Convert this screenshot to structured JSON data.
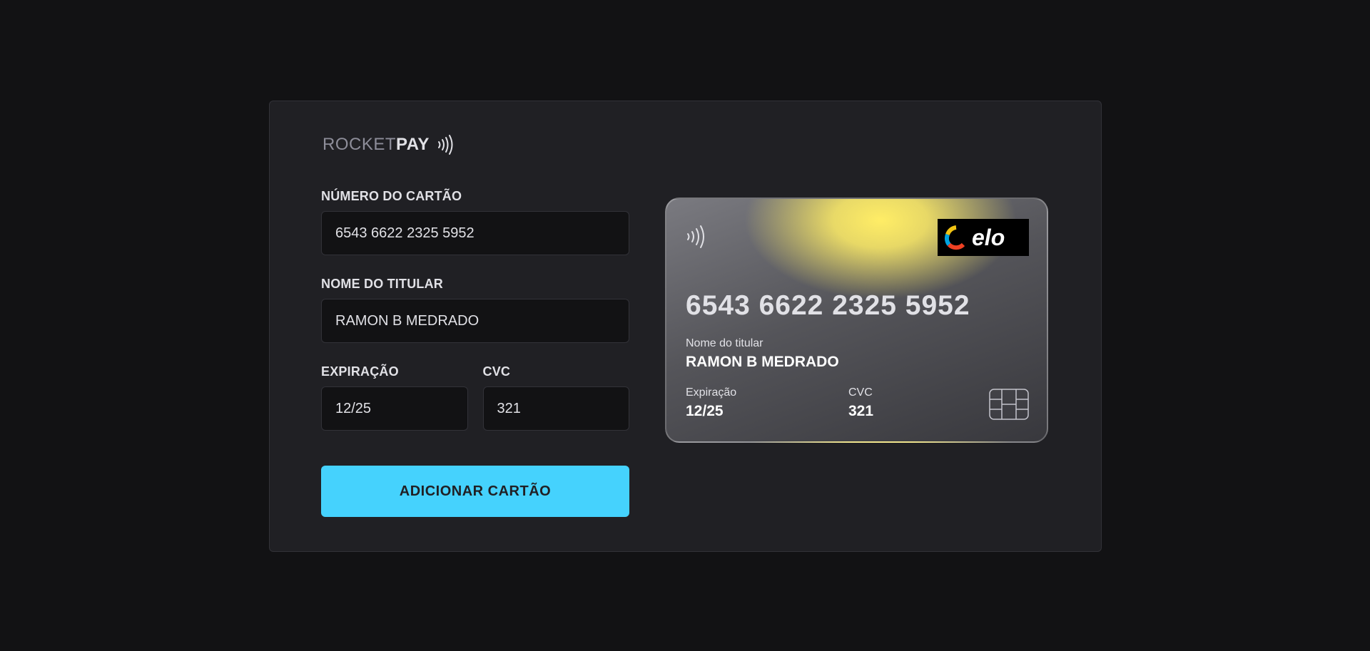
{
  "brand": {
    "logo_part1": "ROCKET",
    "logo_part2": "PAY",
    "icon": "contactless-icon"
  },
  "form": {
    "card_number": {
      "label": "NÚMERO DO CARTÃO",
      "value": "6543 6622 2325 5952"
    },
    "holder_name": {
      "label": "NOME DO TITULAR",
      "value": "RAMON B MEDRADO"
    },
    "expiration": {
      "label": "EXPIRAÇÃO",
      "value": "12/25"
    },
    "cvc": {
      "label": "CVC",
      "value": "321"
    },
    "submit_label": "ADICIONAR CARTÃO"
  },
  "card": {
    "number": "6543 6622 2325 5952",
    "holder_label": "Nome do titular",
    "holder_value": "RAMON B MEDRADO",
    "exp_label": "Expiração",
    "exp_value": "12/25",
    "cvc_label": "CVC",
    "cvc_value": "321",
    "card_brand": "elo",
    "icons": [
      "contactless-icon",
      "elo-logo",
      "chip-icon"
    ]
  },
  "colors": {
    "background": "#121214",
    "panel": "#202024",
    "input_bg": "#121214",
    "accent": "#45d2fd",
    "card_highlight": "#ffed66",
    "text": "#e1e1e6"
  }
}
